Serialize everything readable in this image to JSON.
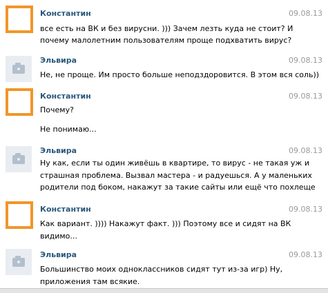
{
  "messages": [
    {
      "author": "Константин",
      "avatar": "orange-square-avatar",
      "date": "09.08.13",
      "lines": [
        "все есть на ВК и без вирусни. ))) Зачем лезть куда не стоит? И",
        "почему малолетним пользователям проще подхватить вирус?"
      ]
    },
    {
      "author": "Эльвира",
      "avatar": "camera-placeholder-avatar",
      "date": "09.08.13",
      "lines": [
        "Не, не проще. Им просто больше неподздоровится. В этом вся соль))"
      ]
    },
    {
      "author": "Константин",
      "avatar": "orange-square-avatar",
      "date": "09.08.13",
      "lines": [
        "Почему?",
        "Не понимаю..."
      ]
    },
    {
      "author": "Эльвира",
      "avatar": "camera-placeholder-avatar",
      "date": "09.08.13",
      "lines": [
        "Ну как, если ты один живёшь в квартире, то вирус - не такая уж и",
        "страшная проблема. Вызвал мастера - и радуешься. А у маленьких",
        "родители под боком, накажут за такие сайты или ещё что похлеще"
      ]
    },
    {
      "author": "Константин",
      "avatar": "orange-square-avatar",
      "date": "09.08.13",
      "lines": [
        "Как вариант. )))) Накажут факт. ))) Поэтому все и сидят на ВК",
        "видимо..."
      ]
    },
    {
      "author": "Эльвира",
      "avatar": "camera-placeholder-avatar",
      "date": "09.08.13",
      "lines": [
        "Большинство моих одноклассников сидят тут из-за игр) Ну,",
        "приложения там всякие."
      ]
    }
  ]
}
